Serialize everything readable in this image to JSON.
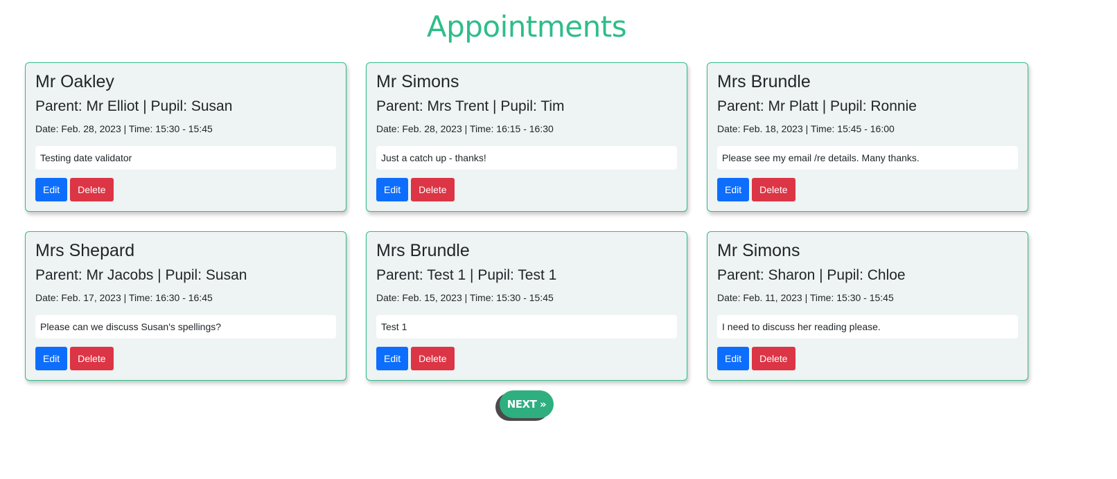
{
  "page": {
    "title": "Appointments",
    "next_label": "NEXT »"
  },
  "colors": {
    "accent": "#2ebd8a",
    "edit": "#0d6efd",
    "delete": "#dc3545",
    "card_bg": "#eef3f3"
  },
  "appointments": [
    {
      "teacher": "Mr Oakley",
      "parent_pupil": "Parent: Mr Elliot | Pupil: Susan",
      "date_time": "Date: Feb. 28, 2023 | Time: 15:30 - 15:45",
      "note": "Testing date validator",
      "edit_label": "Edit",
      "delete_label": "Delete"
    },
    {
      "teacher": "Mr Simons",
      "parent_pupil": "Parent: Mrs Trent | Pupil: Tim",
      "date_time": "Date: Feb. 28, 2023 | Time: 16:15 - 16:30",
      "note": "Just a catch up - thanks!",
      "edit_label": "Edit",
      "delete_label": "Delete"
    },
    {
      "teacher": "Mrs Brundle",
      "parent_pupil": "Parent: Mr Platt | Pupil: Ronnie",
      "date_time": "Date: Feb. 18, 2023 | Time: 15:45 - 16:00",
      "note": "Please see my email /re details. Many thanks.",
      "edit_label": "Edit",
      "delete_label": "Delete"
    },
    {
      "teacher": "Mrs Shepard",
      "parent_pupil": "Parent: Mr Jacobs | Pupil: Susan",
      "date_time": "Date: Feb. 17, 2023 | Time: 16:30 - 16:45",
      "note": "Please can we discuss Susan's spellings?",
      "edit_label": "Edit",
      "delete_label": "Delete"
    },
    {
      "teacher": "Mrs Brundle",
      "parent_pupil": "Parent: Test 1 | Pupil: Test 1",
      "date_time": "Date: Feb. 15, 2023 | Time: 15:30 - 15:45",
      "note": "Test 1",
      "edit_label": "Edit",
      "delete_label": "Delete"
    },
    {
      "teacher": "Mr Simons",
      "parent_pupil": "Parent: Sharon | Pupil: Chloe",
      "date_time": "Date: Feb. 11, 2023 | Time: 15:30 - 15:45",
      "note": "I need to discuss her reading please.",
      "edit_label": "Edit",
      "delete_label": "Delete"
    }
  ]
}
